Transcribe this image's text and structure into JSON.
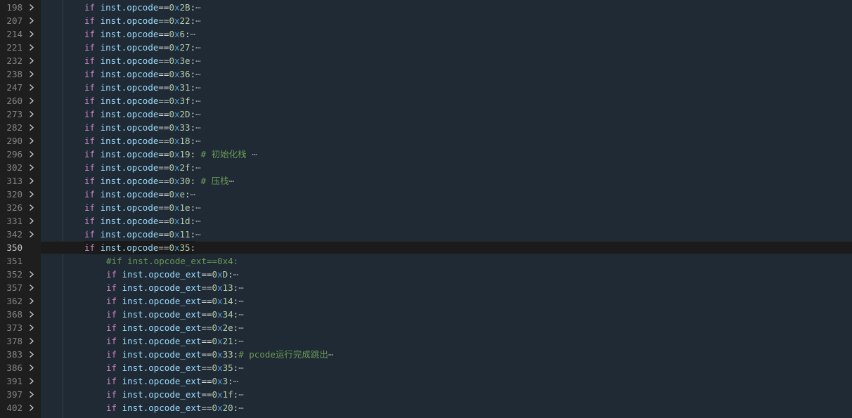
{
  "editor": {
    "lines": [
      {
        "n": "198",
        "folded": true,
        "indent": 2,
        "type": "if",
        "var": "inst.opcode",
        "op": "==",
        "val": "2B",
        "tail": ":",
        "comment": "",
        "ellipsis": "⋯"
      },
      {
        "n": "207",
        "folded": true,
        "indent": 2,
        "type": "if",
        "var": "inst.opcode",
        "op": "==",
        "val": "22",
        "tail": ":",
        "comment": "",
        "ellipsis": "⋯"
      },
      {
        "n": "214",
        "folded": true,
        "indent": 2,
        "type": "if",
        "var": "inst.opcode",
        "op": "==",
        "val": "6",
        "tail": ":",
        "comment": "",
        "ellipsis": "⋯"
      },
      {
        "n": "221",
        "folded": true,
        "indent": 2,
        "type": "if",
        "var": "inst.opcode",
        "op": "==",
        "val": "27",
        "tail": ":",
        "comment": "",
        "ellipsis": "⋯"
      },
      {
        "n": "232",
        "folded": true,
        "indent": 2,
        "type": "if",
        "var": "inst.opcode",
        "op": "==",
        "val": "3e",
        "tail": ":",
        "comment": "",
        "ellipsis": "⋯"
      },
      {
        "n": "238",
        "folded": true,
        "indent": 2,
        "type": "if",
        "var": "inst.opcode",
        "op": "==",
        "val": "36",
        "tail": ":",
        "comment": "",
        "ellipsis": "⋯"
      },
      {
        "n": "247",
        "folded": true,
        "indent": 2,
        "type": "if",
        "var": "inst.opcode",
        "op": "==",
        "val": "31",
        "tail": ":",
        "comment": "",
        "ellipsis": "⋯"
      },
      {
        "n": "260",
        "folded": true,
        "indent": 2,
        "type": "if",
        "var": "inst.opcode",
        "op": "==",
        "val": "3f",
        "tail": ":",
        "comment": "",
        "ellipsis": "⋯"
      },
      {
        "n": "273",
        "folded": true,
        "indent": 2,
        "type": "if",
        "var": "inst.opcode",
        "op": "==",
        "val": "2D",
        "tail": ":",
        "comment": "",
        "ellipsis": "⋯"
      },
      {
        "n": "282",
        "folded": true,
        "indent": 2,
        "type": "if",
        "var": "inst.opcode",
        "op": "==",
        "val": "33",
        "tail": ":",
        "comment": "",
        "ellipsis": "⋯"
      },
      {
        "n": "290",
        "folded": true,
        "indent": 2,
        "type": "if",
        "var": "inst.opcode",
        "op": "==",
        "val": "18",
        "tail": ":",
        "comment": "",
        "ellipsis": "⋯"
      },
      {
        "n": "296",
        "folded": true,
        "indent": 2,
        "type": "if",
        "var": "inst.opcode",
        "op": "==",
        "val": "19",
        "tail": ":",
        "comment": " # 初始化栈 ",
        "ellipsis": "⋯"
      },
      {
        "n": "302",
        "folded": true,
        "indent": 2,
        "type": "if",
        "var": "inst.opcode",
        "op": "==",
        "val": "2f",
        "tail": ":",
        "comment": "",
        "ellipsis": "⋯"
      },
      {
        "n": "313",
        "folded": true,
        "indent": 2,
        "type": "if",
        "var": "inst.opcode",
        "op": "==",
        "val": "30",
        "tail": ":",
        "comment": " # 压栈",
        "ellipsis": "⋯"
      },
      {
        "n": "320",
        "folded": true,
        "indent": 2,
        "type": "if",
        "var": "inst.opcode",
        "op": "==",
        "val": "e",
        "tail": ":",
        "comment": "",
        "ellipsis": "⋯"
      },
      {
        "n": "326",
        "folded": true,
        "indent": 2,
        "type": "if",
        "var": "inst.opcode",
        "op": "==",
        "val": "1e",
        "tail": ":",
        "comment": "",
        "ellipsis": "⋯"
      },
      {
        "n": "331",
        "folded": true,
        "indent": 2,
        "type": "if",
        "var": "inst.opcode",
        "op": "==",
        "val": "1d",
        "tail": ":",
        "comment": "",
        "ellipsis": "⋯"
      },
      {
        "n": "342",
        "folded": true,
        "indent": 2,
        "type": "if",
        "var": "inst.opcode",
        "op": "==",
        "val": "11",
        "tail": ":",
        "comment": "",
        "ellipsis": "⋯"
      },
      {
        "n": "350",
        "folded": false,
        "indent": 2,
        "type": "if",
        "var": "inst.opcode",
        "op": "==",
        "val": "35",
        "tail": ":",
        "comment": "",
        "ellipsis": "",
        "current": true
      },
      {
        "n": "351",
        "folded": false,
        "indent": 3,
        "type": "comment",
        "text": "#if inst.opcode_ext==0x4:"
      },
      {
        "n": "352",
        "folded": true,
        "indent": 3,
        "type": "if",
        "var": "inst.opcode_ext",
        "op": "==",
        "val": "D",
        "tail": ":",
        "comment": "",
        "ellipsis": "⋯"
      },
      {
        "n": "357",
        "folded": true,
        "indent": 3,
        "type": "if",
        "var": "inst.opcode_ext",
        "op": "==",
        "val": "13",
        "tail": ":",
        "comment": "",
        "ellipsis": "⋯"
      },
      {
        "n": "362",
        "folded": true,
        "indent": 3,
        "type": "if",
        "var": "inst.opcode_ext",
        "op": "==",
        "val": "14",
        "tail": ":",
        "comment": "",
        "ellipsis": "⋯"
      },
      {
        "n": "368",
        "folded": true,
        "indent": 3,
        "type": "if",
        "var": "inst.opcode_ext",
        "op": "==",
        "val": "34",
        "tail": ":",
        "comment": "",
        "ellipsis": "⋯"
      },
      {
        "n": "373",
        "folded": true,
        "indent": 3,
        "type": "if",
        "var": "inst.opcode_ext",
        "op": "==",
        "val": "2e",
        "tail": ":",
        "comment": "",
        "ellipsis": "⋯"
      },
      {
        "n": "378",
        "folded": true,
        "indent": 3,
        "type": "if",
        "var": "inst.opcode_ext",
        "op": "==",
        "val": "21",
        "tail": ":",
        "comment": "",
        "ellipsis": "⋯"
      },
      {
        "n": "383",
        "folded": true,
        "indent": 3,
        "type": "if",
        "var": "inst.opcode_ext",
        "op": "==",
        "val": "33",
        "tail": ":",
        "comment": "# pcode运行完成跳出",
        "ellipsis": "⋯"
      },
      {
        "n": "386",
        "folded": true,
        "indent": 3,
        "type": "if",
        "var": "inst.opcode_ext",
        "op": "==",
        "val": "35",
        "tail": ":",
        "comment": "",
        "ellipsis": "⋯"
      },
      {
        "n": "391",
        "folded": true,
        "indent": 3,
        "type": "if",
        "var": "inst.opcode_ext",
        "op": "==",
        "val": "3",
        "tail": ":",
        "comment": "",
        "ellipsis": "⋯"
      },
      {
        "n": "397",
        "folded": true,
        "indent": 3,
        "type": "if",
        "var": "inst.opcode_ext",
        "op": "==",
        "val": "1f",
        "tail": ":",
        "comment": "",
        "ellipsis": "⋯"
      },
      {
        "n": "402",
        "folded": true,
        "indent": 3,
        "type": "if",
        "var": "inst.opcode_ext",
        "op": "==",
        "val": "20",
        "tail": ":",
        "comment": "",
        "ellipsis": "⋯"
      }
    ],
    "keyword_if": "if",
    "hex_prefix_0": "0",
    "hex_prefix_x": "x",
    "colors": {
      "keyword": "#c586c0",
      "variable": "#9cdcfe",
      "number": "#b5cea8",
      "comment": "#6a9955",
      "line_number": "#858585"
    },
    "icons": {
      "fold": "chevron-right-icon"
    }
  }
}
